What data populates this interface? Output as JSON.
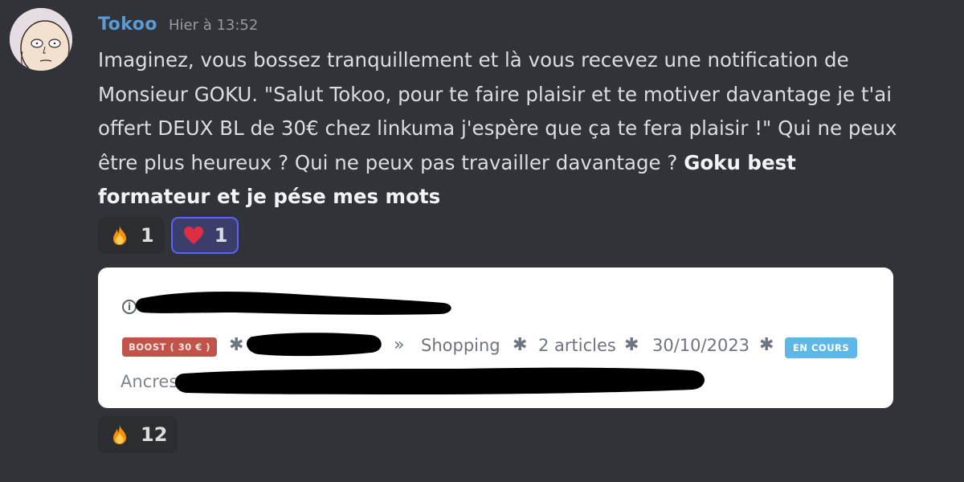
{
  "message": {
    "author": "Tokoo",
    "timestamp": "Hier à 13:52",
    "text_part1": "Imaginez, vous bossez tranquillement et là vous recevez une notification de Monsieur GOKU. \"Salut Tokoo, pour te faire plaisir et te motiver davantage je t'ai offert DEUX BL de 30€ chez linkuma j'espère que ça te fera plaisir !\" Qui ne peux être plus heureux ? Qui ne peux pas travailler davantage ? ",
    "text_bold": "Goku best formateur et je pése mes mots"
  },
  "reactions": [
    {
      "emoji": "fire-icon",
      "count": "1",
      "active": false
    },
    {
      "emoji": "heart-icon",
      "count": "1",
      "active": true
    }
  ],
  "attachment": {
    "info_icon": "ⓘ",
    "boost_badge": "BOOST ( 30 € )",
    "separator": "✱",
    "chevron": "»",
    "category": "Shopping",
    "articles": "2 articles",
    "date": "30/10/2023",
    "status_badge": "EN COURS",
    "anchors_label": "Ancres :"
  },
  "attachment_reactions": [
    {
      "emoji": "fire-icon",
      "count": "12"
    }
  ],
  "colors": {
    "background": "#313338",
    "username": "#5a9ad6",
    "active_reaction_border": "#5865f2",
    "boost_badge": "#c0544a",
    "status_badge": "#5fb7e8"
  }
}
